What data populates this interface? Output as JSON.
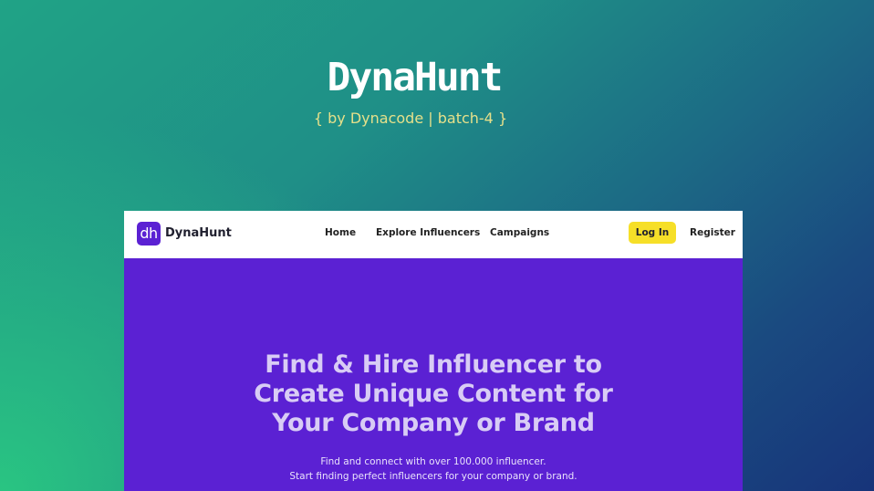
{
  "hero": {
    "title": "DynaHunt",
    "subtitle": "{ by Dynacode | batch-4 }"
  },
  "app": {
    "logo_badge": "dh",
    "logo_text": "DynaHunt",
    "nav": {
      "home": "Home",
      "explore": "Explore Influencers",
      "campaigns": "Campaigns"
    },
    "auth": {
      "login": "Log In",
      "register": "Register"
    },
    "headline": {
      "line1": "Find & Hire Influencer to",
      "line2": "Create Unique Content for",
      "line3": "Your Company or Brand"
    },
    "tagline": {
      "line1": "Find and connect with over 100.000 influencer.",
      "line2": "Start finding perfect influencers for your company or brand."
    }
  },
  "colors": {
    "brand_purple": "#5b21d3",
    "login_yellow": "#f6df28",
    "subtitle_yellow": "#e6e08a"
  }
}
